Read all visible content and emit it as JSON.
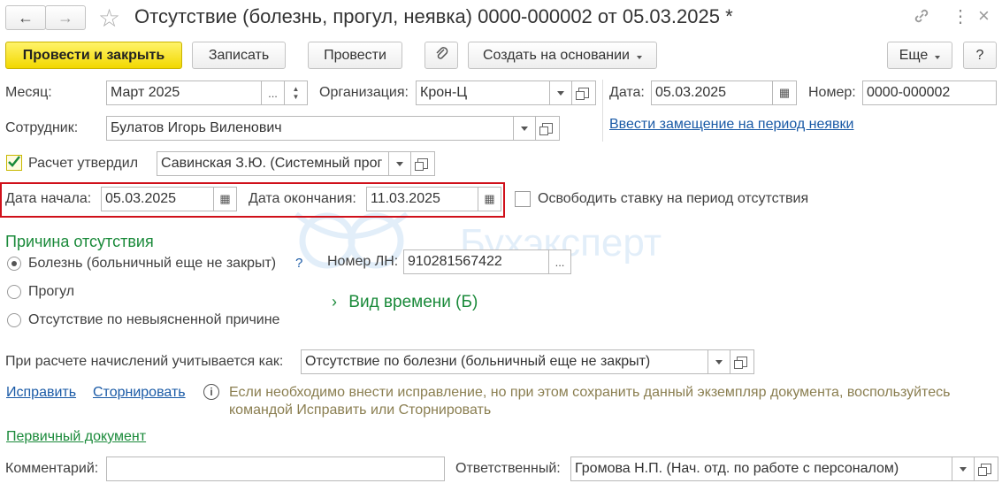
{
  "header": {
    "title": "Отсутствие (болезнь, прогул, неявка) 0000-000002 от 05.03.2025 *"
  },
  "toolbar": {
    "post_close": "Провести и закрыть",
    "save": "Записать",
    "post": "Провести",
    "create_based": "Создать на основании",
    "more": "Еще",
    "help": "?"
  },
  "form": {
    "month_label": "Месяц:",
    "month_value": "Март 2025",
    "org_label": "Организация:",
    "org_value": "Крон-Ц",
    "date_label": "Дата:",
    "date_value": "05.03.2025",
    "number_label": "Номер:",
    "number_value": "0000-000002",
    "employee_label": "Сотрудник:",
    "employee_value": "Булатов Игорь Виленович",
    "substitution_link": "Ввести замещение на период неявки",
    "approved_label": "Расчет утвердил",
    "approved_value": "Савинская З.Ю. (Системный прог",
    "start_label": "Дата начала:",
    "start_value": "05.03.2025",
    "end_label": "Дата окончания:",
    "end_value": "11.03.2025",
    "free_rate_label": "Освободить ставку на период отсутствия"
  },
  "reason": {
    "title": "Причина отсутствия",
    "options": [
      {
        "label": "Болезнь (больничный еще не закрыт)",
        "selected": true
      },
      {
        "label": "Прогул",
        "selected": false
      },
      {
        "label": "Отсутствие по невыясненной причине",
        "selected": false
      }
    ],
    "help": "?",
    "ln_label": "Номер ЛН:",
    "ln_value": "910281567422",
    "time_type": "Вид времени (Б)"
  },
  "accrual": {
    "label": "При расчете начислений учитывается как:",
    "value": "Отсутствие по болезни (больничный еще не закрыт)"
  },
  "actions": {
    "fix": "Исправить",
    "storno": "Сторнировать",
    "info": "Если необходимо внести исправление, но при этом сохранить данный экземпляр документа, воспользуйтесь командой Исправить или Сторнировать",
    "primary_doc": "Первичный документ"
  },
  "footer": {
    "comment_label": "Комментарий:",
    "comment_value": "",
    "responsible_label": "Ответственный:",
    "responsible_value": "Громова Н.П. (Нач. отд. по работе с персоналом)"
  },
  "watermark": "Бухэксперт",
  "colors": {
    "primary_button": "#f2d800",
    "link": "#1a5aa6",
    "green": "#1a8a3a",
    "highlight": "#d0101a"
  }
}
